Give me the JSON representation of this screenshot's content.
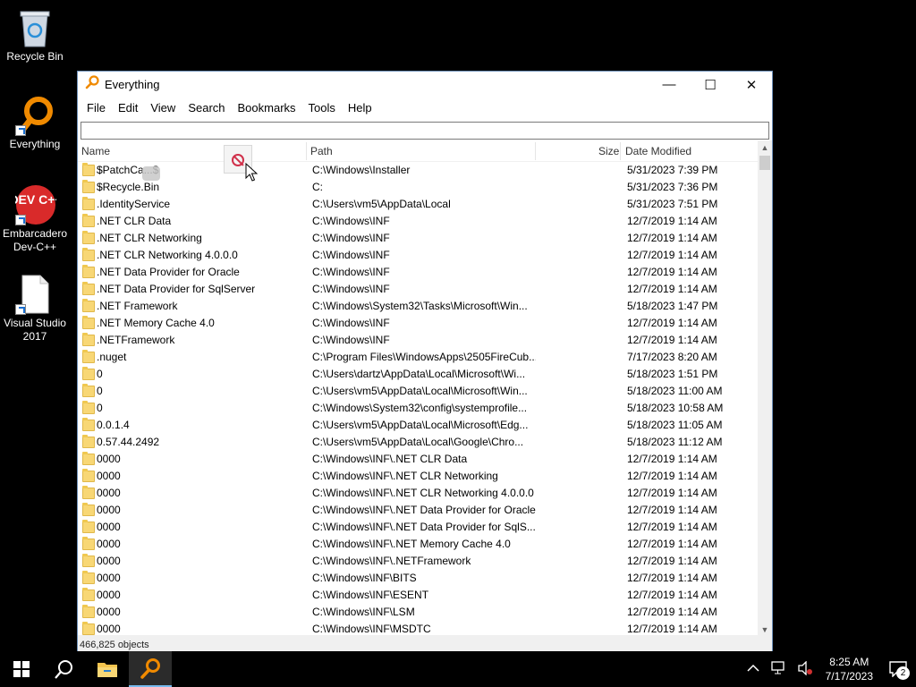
{
  "desktop": {
    "icons": [
      {
        "label": "Recycle Bin",
        "icon": "recycle-bin-icon"
      },
      {
        "label": "Everything",
        "icon": "everything-magnifier-icon"
      },
      {
        "label": "Embarcadero Dev-C++",
        "icon": "devcpp-icon",
        "badge_text": "DEV C++"
      },
      {
        "label": "Visual Studio 2017",
        "icon": "blank-file-icon"
      }
    ]
  },
  "window": {
    "title": "Everything",
    "controls": {
      "minimize": "—",
      "maximize": "☐",
      "close": "✕"
    },
    "menu": [
      "File",
      "Edit",
      "View",
      "Search",
      "Bookmarks",
      "Tools",
      "Help"
    ],
    "search_value": "",
    "columns": {
      "name": "Name",
      "path": "Path",
      "size": "Size",
      "date": "Date Modified"
    },
    "rows": [
      {
        "name": "$PatchCa...$",
        "path": "C:\\Windows\\Installer",
        "date": "5/31/2023 7:39 PM"
      },
      {
        "name": "$Recycle.Bin",
        "path": "C:",
        "date": "5/31/2023 7:36 PM"
      },
      {
        "name": ".IdentityService",
        "path": "C:\\Users\\vm5\\AppData\\Local",
        "date": "5/31/2023 7:51 PM"
      },
      {
        "name": ".NET CLR Data",
        "path": "C:\\Windows\\INF",
        "date": "12/7/2019 1:14 AM"
      },
      {
        "name": ".NET CLR Networking",
        "path": "C:\\Windows\\INF",
        "date": "12/7/2019 1:14 AM"
      },
      {
        "name": ".NET CLR Networking 4.0.0.0",
        "path": "C:\\Windows\\INF",
        "date": "12/7/2019 1:14 AM"
      },
      {
        "name": ".NET Data Provider for Oracle",
        "path": "C:\\Windows\\INF",
        "date": "12/7/2019 1:14 AM"
      },
      {
        "name": ".NET Data Provider for SqlServer",
        "path": "C:\\Windows\\INF",
        "date": "12/7/2019 1:14 AM"
      },
      {
        "name": ".NET Framework",
        "path": "C:\\Windows\\System32\\Tasks\\Microsoft\\Win...",
        "date": "5/18/2023 1:47 PM"
      },
      {
        "name": ".NET Memory Cache 4.0",
        "path": "C:\\Windows\\INF",
        "date": "12/7/2019 1:14 AM"
      },
      {
        "name": ".NETFramework",
        "path": "C:\\Windows\\INF",
        "date": "12/7/2019 1:14 AM"
      },
      {
        "name": ".nuget",
        "path": "C:\\Program Files\\WindowsApps\\2505FireCub...",
        "date": "7/17/2023 8:20 AM"
      },
      {
        "name": "0",
        "path": "C:\\Users\\dartz\\AppData\\Local\\Microsoft\\Wi...",
        "date": "5/18/2023 1:51 PM"
      },
      {
        "name": "0",
        "path": "C:\\Users\\vm5\\AppData\\Local\\Microsoft\\Win...",
        "date": "5/18/2023 11:00 AM"
      },
      {
        "name": "0",
        "path": "C:\\Windows\\System32\\config\\systemprofile...",
        "date": "5/18/2023 10:58 AM"
      },
      {
        "name": "0.0.1.4",
        "path": "C:\\Users\\vm5\\AppData\\Local\\Microsoft\\Edg...",
        "date": "5/18/2023 11:05 AM"
      },
      {
        "name": "0.57.44.2492",
        "path": "C:\\Users\\vm5\\AppData\\Local\\Google\\Chro...",
        "date": "5/18/2023 11:12 AM"
      },
      {
        "name": "0000",
        "path": "C:\\Windows\\INF\\.NET CLR Data",
        "date": "12/7/2019 1:14 AM"
      },
      {
        "name": "0000",
        "path": "C:\\Windows\\INF\\.NET CLR Networking",
        "date": "12/7/2019 1:14 AM"
      },
      {
        "name": "0000",
        "path": "C:\\Windows\\INF\\.NET CLR Networking 4.0.0.0",
        "date": "12/7/2019 1:14 AM"
      },
      {
        "name": "0000",
        "path": "C:\\Windows\\INF\\.NET Data Provider for Oracle",
        "date": "12/7/2019 1:14 AM"
      },
      {
        "name": "0000",
        "path": "C:\\Windows\\INF\\.NET Data Provider for SqlS...",
        "date": "12/7/2019 1:14 AM"
      },
      {
        "name": "0000",
        "path": "C:\\Windows\\INF\\.NET Memory Cache 4.0",
        "date": "12/7/2019 1:14 AM"
      },
      {
        "name": "0000",
        "path": "C:\\Windows\\INF\\.NETFramework",
        "date": "12/7/2019 1:14 AM"
      },
      {
        "name": "0000",
        "path": "C:\\Windows\\INF\\BITS",
        "date": "12/7/2019 1:14 AM"
      },
      {
        "name": "0000",
        "path": "C:\\Windows\\INF\\ESENT",
        "date": "12/7/2019 1:14 AM"
      },
      {
        "name": "0000",
        "path": "C:\\Windows\\INF\\LSM",
        "date": "12/7/2019 1:14 AM"
      },
      {
        "name": "0000",
        "path": "C:\\Windows\\INF\\MSDTC",
        "date": "12/7/2019 1:14 AM"
      }
    ],
    "status": "466,825 objects"
  },
  "taskbar": {
    "clock_time": "8:25 AM",
    "clock_date": "7/17/2023",
    "notification_count": "2",
    "accent": "#76b9ed"
  }
}
